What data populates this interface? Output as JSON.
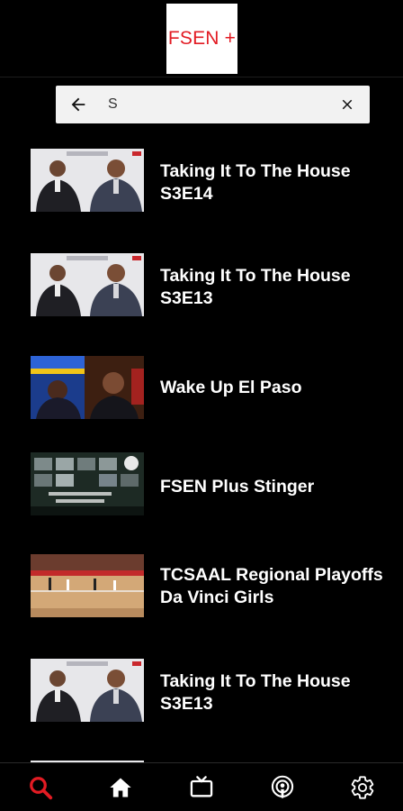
{
  "header": {
    "logo_text": "FSEN +"
  },
  "search": {
    "value": "S",
    "placeholder": ""
  },
  "results": [
    {
      "title": "Taking It To The House S3E14",
      "thumb": "house"
    },
    {
      "title": "Taking It To The House S3E13",
      "thumb": "house"
    },
    {
      "title": "Wake Up El Paso",
      "thumb": "wake"
    },
    {
      "title": "FSEN Plus Stinger",
      "thumb": "stinger"
    },
    {
      "title": "TCSAAL Regional Playoffs Da Vinci Girls",
      "thumb": "gym"
    },
    {
      "title": "Taking It To The House S3E13",
      "thumb": "house"
    }
  ],
  "bottom_nav": [
    {
      "icon": "search-icon",
      "active": true
    },
    {
      "icon": "home-icon",
      "active": false
    },
    {
      "icon": "tv-icon",
      "active": false
    },
    {
      "icon": "podcast-icon",
      "active": false
    },
    {
      "icon": "gear-icon",
      "active": false
    }
  ],
  "colors": {
    "accent": "#e21b23",
    "background": "#000000",
    "search_bg": "#f2f2f2"
  }
}
